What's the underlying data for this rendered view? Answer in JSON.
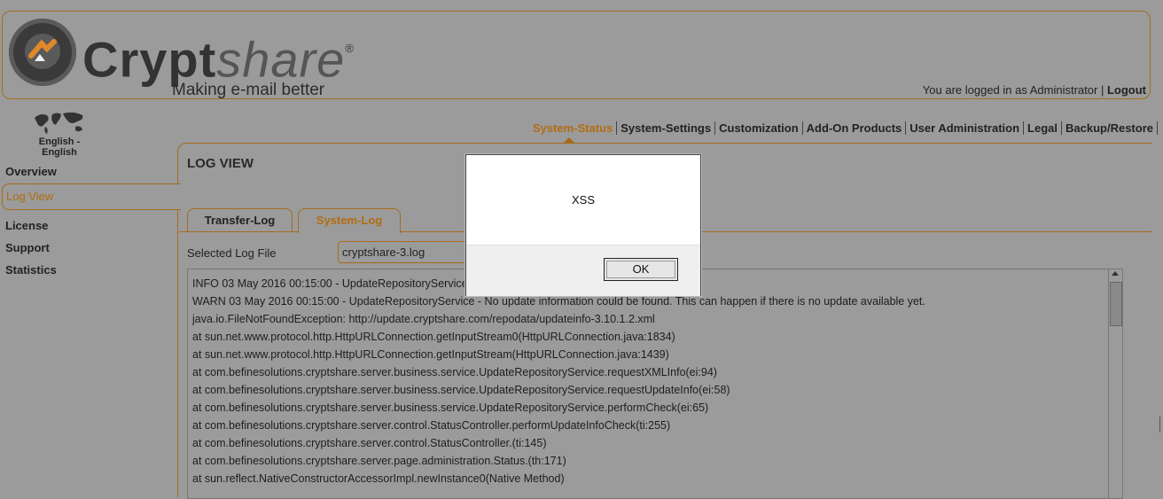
{
  "header": {
    "brand_main": "Crypt",
    "brand_share": "share",
    "brand_reg": "®",
    "tagline": "Making e-mail better",
    "logged_in_prefix": "You are logged in as Administrator |",
    "logout_label": "Logout"
  },
  "language": {
    "label": "English - English"
  },
  "topnav": {
    "items": [
      {
        "label": "System-Status",
        "active": true
      },
      {
        "label": "System-Settings"
      },
      {
        "label": "Customization"
      },
      {
        "label": "Add-On Products"
      },
      {
        "label": "User Administration"
      },
      {
        "label": "Legal"
      },
      {
        "label": "Backup/Restore"
      }
    ]
  },
  "sidebar": {
    "items": [
      {
        "label": "Overview"
      },
      {
        "label": "Log View",
        "active": true
      },
      {
        "label": "License"
      },
      {
        "label": "Support"
      },
      {
        "label": "Statistics"
      }
    ]
  },
  "main": {
    "title": "LOG VIEW",
    "tabs": [
      {
        "label": "Transfer-Log"
      },
      {
        "label": "System-Log",
        "active": true
      }
    ],
    "selected_log_label": "Selected Log File",
    "selected_log_value": "cryptshare-3.log",
    "log_lines": [
      "INFO 03 May 2016 00:15:00 - UpdateRepositoryService",
      "WARN 03 May 2016 00:15:00 - UpdateRepositoryService - No update information could be found. This can happen if there is no update available yet.",
      "java.io.FileNotFoundException: http://update.cryptshare.com/repodata/updateinfo-3.10.1.2.xml",
      "at sun.net.www.protocol.http.HttpURLConnection.getInputStream0(HttpURLConnection.java:1834)",
      "at sun.net.www.protocol.http.HttpURLConnection.getInputStream(HttpURLConnection.java:1439)",
      "at com.befinesolutions.cryptshare.server.business.service.UpdateRepositoryService.requestXMLInfo(ei:94)",
      "at com.befinesolutions.cryptshare.server.business.service.UpdateRepositoryService.requestUpdateInfo(ei:58)",
      "at com.befinesolutions.cryptshare.server.business.service.UpdateRepositoryService.performCheck(ei:65)",
      "at com.befinesolutions.cryptshare.server.control.StatusController.performUpdateInfoCheck(ti:255)",
      "at com.befinesolutions.cryptshare.server.control.StatusController.(ti:145)",
      "at com.befinesolutions.cryptshare.server.page.administration.Status.(th:171)",
      "at sun.reflect.NativeConstructorAccessorImpl.newInstance0(Native Method)"
    ]
  },
  "dialog": {
    "message": "XSS",
    "ok_label": "OK"
  },
  "colors": {
    "accent": "#b26c12",
    "overlay_background": "#9b9b9b",
    "dialog_background": "#ffffff"
  },
  "icons": {
    "logo": "cryptshare-logo-icon",
    "language": "world-map-icon",
    "nav_pointer": "caret-up-icon",
    "scroll_up": "arrow-up-icon"
  }
}
